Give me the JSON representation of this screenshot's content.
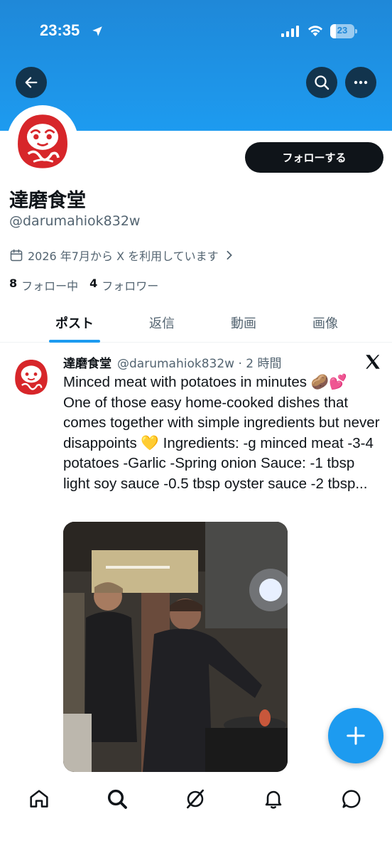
{
  "status_bar": {
    "time": "23:35",
    "battery": "23",
    "battery_level": 0.23
  },
  "header": {
    "back_icon": "arrow-left-icon",
    "search_icon": "search-icon",
    "more_icon": "more-horizontal-icon"
  },
  "profile": {
    "display_name": "達磨食堂",
    "handle": "@darumahiok832w",
    "joined": "2026 年7月から X を利用しています",
    "follow_label": "フォローする",
    "following_count": "8",
    "following_label": "フォロー中",
    "followers_count": "4",
    "followers_label": "フォロワー"
  },
  "tabs": [
    {
      "label": "ポスト",
      "active": true
    },
    {
      "label": "返信",
      "active": false
    },
    {
      "label": "動画",
      "active": false
    },
    {
      "label": "画像",
      "active": false
    }
  ],
  "post": {
    "author": "達磨食堂",
    "meta": "@darumahiok832w · 2 時間",
    "line1": "Minced meat with potatoes in minutes 🥔💕",
    "line2": "One of those easy home-cooked dishes that comes together with simple ingredients but never disappoints 💛 Ingredients: -g minced meat -3-4 potatoes -Garlic -Spring onion Sauce: -1 tbsp light soy sauce -0.5 tbsp oyster sauce -2 tbsp..."
  },
  "colors": {
    "accent": "#1d9bf0",
    "banner": "#1f88d8",
    "text": "#0f1419",
    "muted": "#536471"
  },
  "bottom_nav": [
    "home-icon",
    "search-icon",
    "grok-icon",
    "notifications-icon",
    "messages-icon"
  ]
}
